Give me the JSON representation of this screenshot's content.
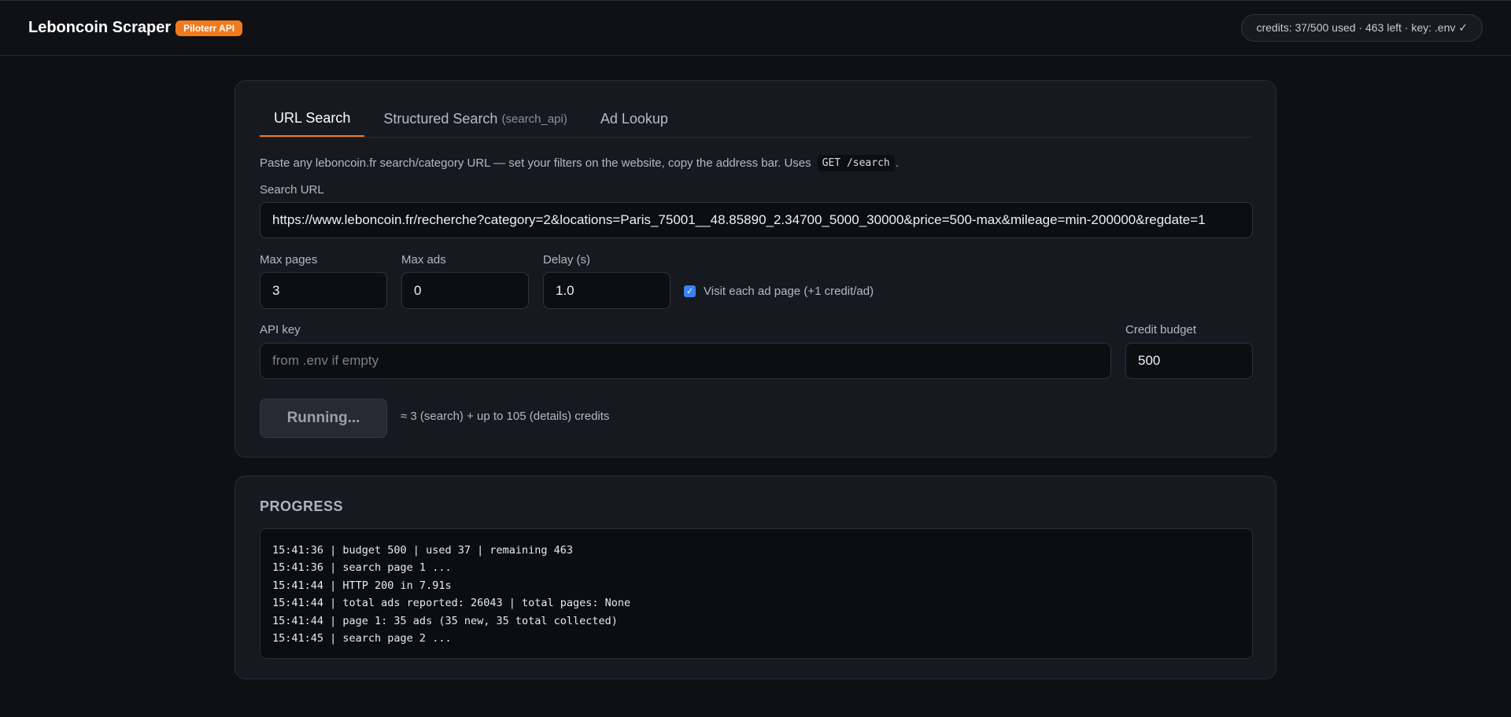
{
  "header": {
    "title": "Leboncoin Scraper",
    "badge": "Piloterr API",
    "credits": "credits: 37/500 used · 463 left · key: .env ✓"
  },
  "tabs": [
    {
      "label": "URL Search",
      "hint": "",
      "active": true
    },
    {
      "label": "Structured Search",
      "hint": "(search_api)",
      "active": false
    },
    {
      "label": "Ad Lookup",
      "hint": "",
      "active": false
    }
  ],
  "form": {
    "description_prefix": "Paste any leboncoin.fr search/category URL — set your filters on the website, copy the address bar. Uses",
    "description_code": "GET /search",
    "description_suffix": ".",
    "search_url_label": "Search URL",
    "search_url_value": "https://www.leboncoin.fr/recherche?category=2&locations=Paris_75001__48.85890_2.34700_5000_30000&price=500-max&mileage=min-200000&regdate=1",
    "max_pages_label": "Max pages",
    "max_pages_value": "3",
    "max_ads_label": "Max ads",
    "max_ads_value": "0",
    "delay_label": "Delay (s)",
    "delay_value": "1.0",
    "visit_label": "Visit each ad page (+1 credit/ad)",
    "visit_checked": true,
    "api_key_label": "API key",
    "api_key_placeholder": "from .env if empty",
    "credit_budget_label": "Credit budget",
    "credit_budget_value": "500",
    "run_button": "Running...",
    "estimate": "≈ 3 (search) + up to 105 (details) credits"
  },
  "progress": {
    "title": "PROGRESS",
    "log": [
      "15:41:36 | budget 500 | used 37 | remaining 463",
      "15:41:36 | search page 1 ...",
      "15:41:44 | HTTP 200 in 7.91s",
      "15:41:44 | total ads reported: 26043 | total pages: None",
      "15:41:44 | page 1: 35 ads (35 new, 35 total collected)",
      "15:41:45 | search page 2 ..."
    ]
  },
  "colors": {
    "accent": "#f07a1e",
    "checkbox": "#3b82f6",
    "background": "#0e1014"
  },
  "icons": {
    "checkbox": "checkmark-icon"
  }
}
